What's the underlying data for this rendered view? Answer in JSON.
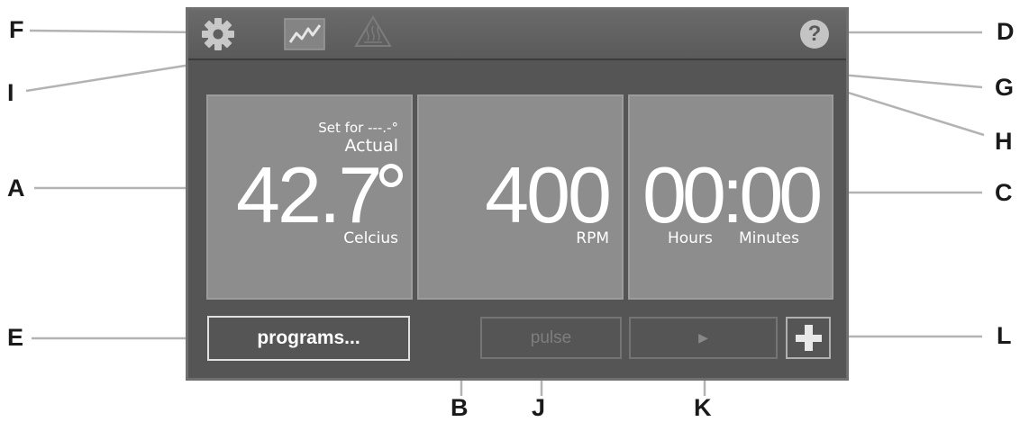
{
  "callouts": {
    "A": "A",
    "B": "B",
    "C": "C",
    "D": "D",
    "E": "E",
    "F": "F",
    "G": "G",
    "H": "H",
    "I": "I",
    "J": "J",
    "K": "K",
    "L": "L"
  },
  "toolbar": {
    "settings_icon": "gear-icon",
    "graph_icon": "graph-icon",
    "warning_icon": "hot-surface-warning-icon",
    "help_icon": "help-icon",
    "help_glyph": "?"
  },
  "temperature": {
    "set_for": "Set for ---.-°",
    "actual_label": "Actual",
    "value": "42.7",
    "unit": "Celcius"
  },
  "speed": {
    "value": "400",
    "unit": "RPM"
  },
  "timer": {
    "value": "00:00",
    "hours_label": "Hours",
    "minutes_label": "Minutes"
  },
  "buttons": {
    "programs_label": "programs...",
    "pulse_label": "pulse",
    "play_glyph": "▶",
    "plus_glyph": "+"
  },
  "colors": {
    "screen_bg": "#555555",
    "tile_bg": "#8d8d8d",
    "text_white": "#ffffff",
    "disabled": "#7c7c7c",
    "leader_line": "#b3b3b3"
  }
}
